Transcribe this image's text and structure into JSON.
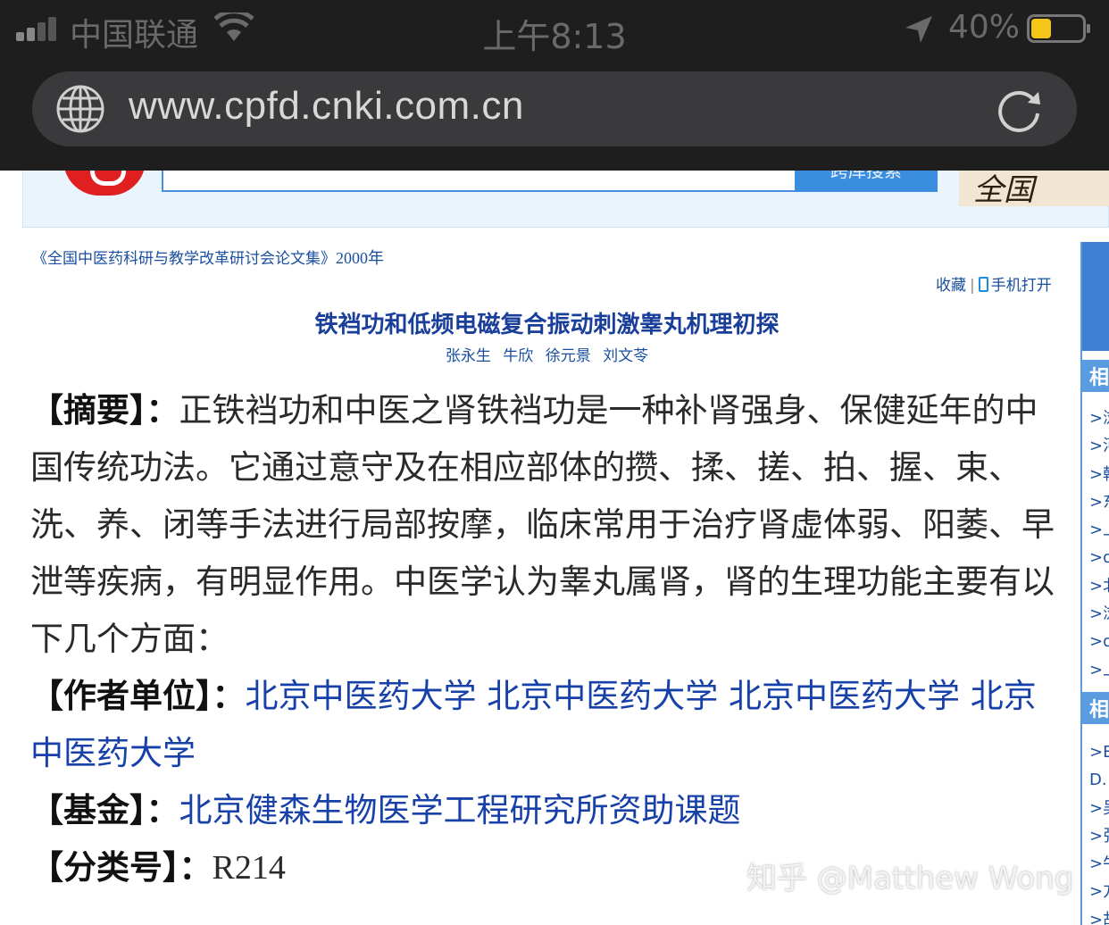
{
  "status_bar": {
    "carrier": "中国联通",
    "time": "上午8:13",
    "battery_percent": "40%",
    "battery_level": 0.4
  },
  "address_bar": {
    "url": "www.cpfd.cnki.com.cn"
  },
  "header": {
    "search_button_label": "跨库搜索",
    "banner_text": "全国"
  },
  "article": {
    "source": "《全国中医药科研与教学改革研讨会论文集》",
    "year": "2000年",
    "tools": {
      "favorite": "收藏",
      "separator": "|",
      "mobile_open": "手机打开"
    },
    "title": "铁裆功和低频电磁复合振动刺激睾丸机理初探",
    "authors": [
      "张永生",
      "牛欣",
      "徐元景",
      "刘文苓"
    ],
    "abstract_label": "【摘要】：",
    "abstract": "正铁裆功和中医之肾铁裆功是一种补肾强身、保健延年的中国传统功法。它通过意守及在相应部体的攒、揉、搓、拍、握、束、洗、养、闭等手法进行局部按摩，临床常用于治疗肾虚体弱、阳萎、早泄等疾病，有明显作用。中医学认为睾丸属肾，肾的生理功能主要有以下几个方面：",
    "affiliation_label": "【作者单位】：",
    "affiliations": [
      "北京中医药大学",
      "北京中医药大学",
      "北京中医药大学",
      "北京中医药大学"
    ],
    "fund_label": "【基金】：",
    "fund": "北京健森生物医学工程研究所资助课题",
    "class_label": "【分类号】：",
    "class_number": "R214"
  },
  "sidebar": {
    "section1_heading": "相",
    "section1_items": [
      ">浏",
      ">河",
      ">韩",
      ">东",
      ">上",
      ">d",
      ">北",
      ">浏",
      ">d",
      ">上"
    ],
    "section2_heading": "相",
    "section2_items": [
      ">E",
      "D.",
      ">吴",
      ">张",
      ">牛",
      ">方",
      ">胡"
    ]
  },
  "watermark": "知乎 @Matthew Wong"
}
